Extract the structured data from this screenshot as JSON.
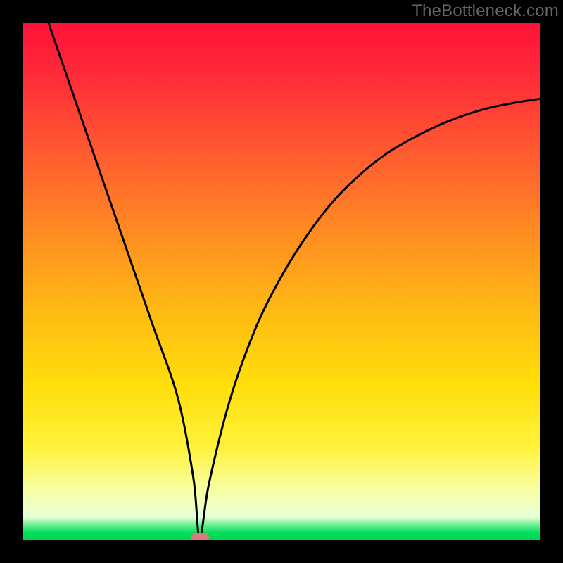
{
  "watermark": "TheBottleneck.com",
  "chart_data": {
    "type": "line",
    "title": "",
    "xlabel": "",
    "ylabel": "",
    "xlim": [
      0,
      100
    ],
    "ylim": [
      0,
      100
    ],
    "background_gradient": [
      "#ff1a3a",
      "#ffd400",
      "#00e05a"
    ],
    "series": [
      {
        "name": "bottleneck-curve",
        "x": [
          5,
          10,
          15,
          20,
          25,
          30,
          33,
          34.2,
          36,
          40,
          45,
          50,
          55,
          60,
          65,
          70,
          75,
          80,
          85,
          90,
          95,
          100
        ],
        "y": [
          100,
          85.5,
          71,
          56.5,
          42,
          27.5,
          12,
          0.5,
          11,
          27,
          41,
          51,
          59,
          65.5,
          70.5,
          74.5,
          77.5,
          80,
          82,
          83.5,
          84.5,
          85.3
        ]
      }
    ],
    "marker": {
      "x": 34.2,
      "y": 0.5,
      "name": "optimal-point"
    },
    "green_band_fraction": 0.045
  }
}
